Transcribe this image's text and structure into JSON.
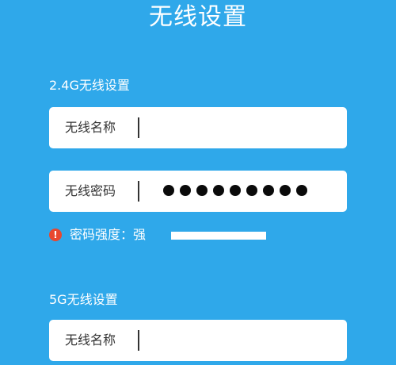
{
  "page": {
    "title": "无线设置"
  },
  "band_24g": {
    "section_label": "2.4G无线设置",
    "ssid": {
      "label": "无线名称",
      "value": ""
    },
    "password": {
      "label": "无线密码",
      "masked_length": 9
    },
    "strength": {
      "label": "密码强度：",
      "level_text": "强",
      "level_fraction": 1.0,
      "icon": "warning-icon"
    }
  },
  "band_5g": {
    "section_label": "5G无线设置",
    "ssid": {
      "label": "无线名称",
      "value": ""
    }
  },
  "colors": {
    "background": "#2fa8ea",
    "field_background": "#ffffff",
    "warning": "#e8472f"
  }
}
